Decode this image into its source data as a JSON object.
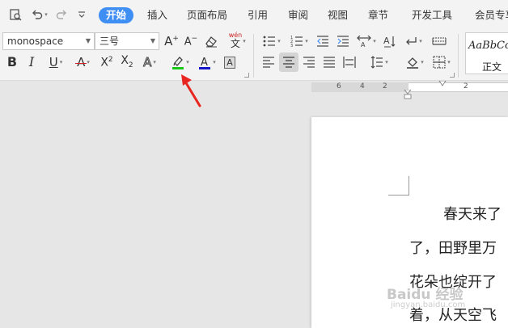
{
  "menu": {
    "tabs": [
      {
        "label": "开始",
        "active": true
      },
      {
        "label": "插入"
      },
      {
        "label": "页面布局"
      },
      {
        "label": "引用"
      },
      {
        "label": "审阅"
      },
      {
        "label": "视图"
      },
      {
        "label": "章节"
      },
      {
        "label": "开发工具"
      },
      {
        "label": "会员专享"
      }
    ]
  },
  "ribbon": {
    "font_name": "monospace",
    "font_size": "三号",
    "pinyin_label": "wén",
    "pinyin_char": "文",
    "style_sample": "AaBbCc",
    "style_name": "正文",
    "colors": {
      "highlight": "#18c718",
      "font_color": "#1414c8",
      "font_color_underline": "#d12020",
      "accent": "#3f8ef3"
    }
  },
  "ruler": {
    "numbers": [
      "6",
      "4",
      "2",
      "2"
    ]
  },
  "document": {
    "lines": [
      "春天来了",
      "了，田野里万",
      "花朵也绽开了",
      "着，从天空飞"
    ]
  },
  "watermark": {
    "text": "Baidu 经验",
    "sub": "jingyan.baidu.com"
  }
}
